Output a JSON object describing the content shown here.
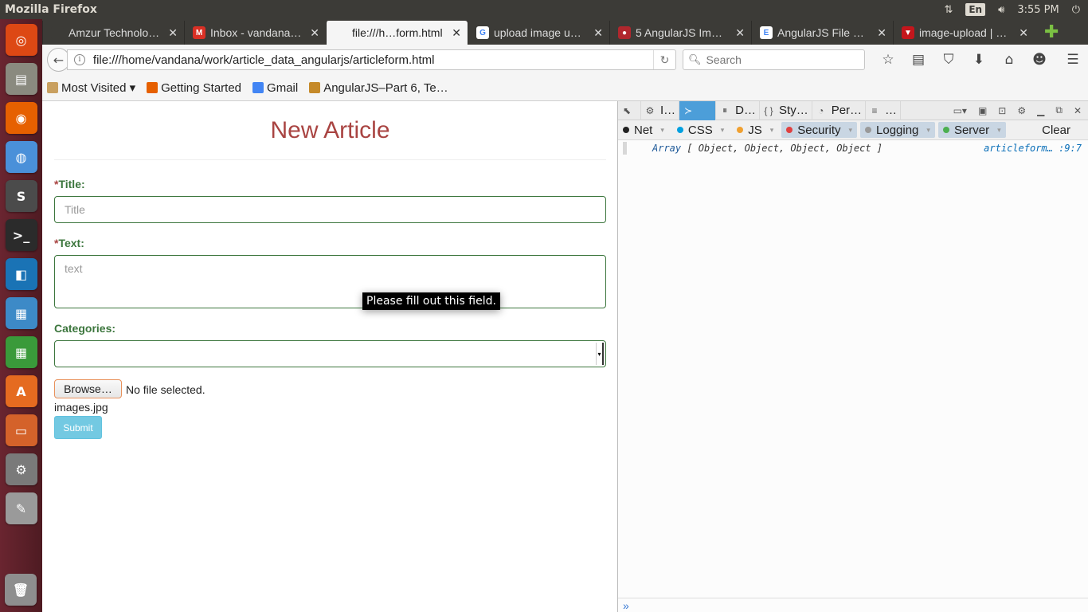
{
  "window": {
    "title": "Mozilla Firefox",
    "lang": "En",
    "time": "3:55 PM"
  },
  "launcher": [
    {
      "name": "ubuntu-dash-icon",
      "color": "#dd4814",
      "glyph": "◎"
    },
    {
      "name": "files-icon",
      "color": "#8a8a7f",
      "glyph": "▤"
    },
    {
      "name": "firefox-icon",
      "color": "#e66000",
      "glyph": "◉"
    },
    {
      "name": "chromium-icon",
      "color": "#4a90d9",
      "glyph": "◍"
    },
    {
      "name": "sublime-icon",
      "color": "#4b4b4b",
      "glyph": "S"
    },
    {
      "name": "terminal-icon",
      "color": "#2b2b2b",
      "glyph": ">_"
    },
    {
      "name": "app-icon",
      "color": "#1a73b5",
      "glyph": "◧"
    },
    {
      "name": "image-viewer-icon",
      "color": "#3d8ac7",
      "glyph": "▦"
    },
    {
      "name": "spreadsheet-icon",
      "color": "#3a9a3a",
      "glyph": "▦"
    },
    {
      "name": "software-center-icon",
      "color": "#e56b20",
      "glyph": "A"
    },
    {
      "name": "presentation-icon",
      "color": "#d4622a",
      "glyph": "▭"
    },
    {
      "name": "settings-icon",
      "color": "#7a7a7a",
      "glyph": "⚙"
    },
    {
      "name": "text-editor-icon",
      "color": "#9a9a9a",
      "glyph": "✎"
    }
  ],
  "tabs": [
    {
      "label": "Amzur Technologi…",
      "icon_color": "#3c3b37",
      "glyph": "",
      "active": false
    },
    {
      "label": "Inbox - vandana…",
      "icon_color": "#d93025",
      "glyph": "M",
      "active": false
    },
    {
      "label": "file:///h…form.html",
      "icon_color": "#f5f5f5",
      "glyph": "",
      "active": true
    },
    {
      "label": "upload image u…",
      "icon_color": "#ffffff",
      "glyph": "G",
      "active": false
    },
    {
      "label": "5 AngularJS Im…",
      "icon_color": "#b0272d",
      "glyph": "●",
      "active": false
    },
    {
      "label": "AngularJS File …",
      "icon_color": "#ffffff",
      "glyph": "E",
      "active": false
    },
    {
      "label": "image-upload | …",
      "icon_color": "#c4161c",
      "glyph": "▼",
      "active": false
    }
  ],
  "nav": {
    "url": "file:///home/vandana/work/article_data_angularjs/articleform.html",
    "search_placeholder": "Search"
  },
  "bookmarks": [
    {
      "label": "Most Visited ▾",
      "color": "#c9a060"
    },
    {
      "label": "Getting Started",
      "color": "#e66000"
    },
    {
      "label": "Gmail",
      "color": "#4285f4"
    },
    {
      "label": "AngularJS–Part 6, Te…",
      "color": "#c58a2a"
    }
  ],
  "form": {
    "heading": "New Article",
    "title_label": "Title:",
    "title_placeholder": "Title",
    "text_label": "Text:",
    "text_placeholder": "text",
    "categories_label": "Categories:",
    "required_mark": "*",
    "browse_label": "Browse…",
    "no_file": "No file selected.",
    "file_name": "images.jpg",
    "submit_label": "Submit",
    "tooltip": "Please fill out this field."
  },
  "devtools": {
    "tabs": [
      {
        "icon": "⬉",
        "label": "",
        "active": false
      },
      {
        "icon": "⚙",
        "label": "I…",
        "active": false
      },
      {
        "icon": "≻",
        "label": "",
        "active": true
      },
      {
        "icon": "⏸",
        "label": "D…",
        "active": false
      },
      {
        "icon": "{ }",
        "label": "Sty…",
        "active": false
      },
      {
        "icon": "◔",
        "label": "Per…",
        "active": false
      },
      {
        "icon": "≡",
        "label": "…",
        "active": false
      }
    ],
    "filters": [
      {
        "label": "Net",
        "color": "#222222",
        "on": false
      },
      {
        "label": "CSS",
        "color": "#00a0e0",
        "on": false
      },
      {
        "label": "JS",
        "color": "#f0a030",
        "on": false
      },
      {
        "label": "Security",
        "color": "#e04040",
        "on": true
      },
      {
        "label": "Logging",
        "color": "#999999",
        "on": true
      },
      {
        "label": "Server",
        "color": "#4caf50",
        "on": true
      }
    ],
    "clear_label": "Clear",
    "log_keyword": "Array",
    "log_body": "[ Object, Object, Object, Object ]",
    "log_source": "articleform… :9:7",
    "prompt": "»"
  }
}
